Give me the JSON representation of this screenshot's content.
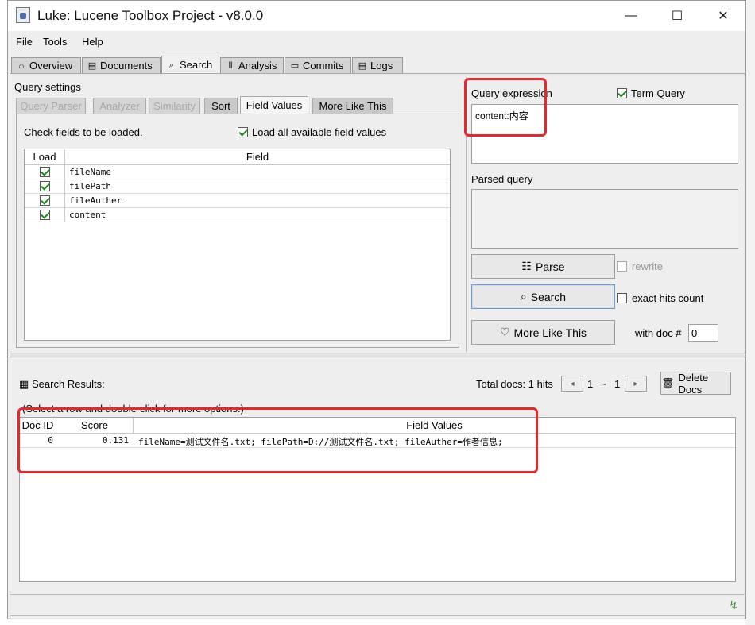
{
  "window": {
    "title": "Luke: Lucene Toolbox Project - v8.0.0"
  },
  "menu": [
    "File",
    "Tools",
    "Help"
  ],
  "main_tabs": [
    {
      "label": "Overview",
      "icon": "home-icon"
    },
    {
      "label": "Documents",
      "icon": "book-icon"
    },
    {
      "label": "Search",
      "icon": "search-doc-icon",
      "active": true
    },
    {
      "label": "Analysis",
      "icon": "analysis-icon"
    },
    {
      "label": "Commits",
      "icon": "commits-icon"
    },
    {
      "label": "Logs",
      "icon": "logs-icon"
    }
  ],
  "query_settings": {
    "title": "Query settings",
    "subtabs": [
      {
        "label": "Query Parser",
        "state": "disabled"
      },
      {
        "label": "Analyzer",
        "state": "disabled"
      },
      {
        "label": "Similarity",
        "state": "disabled"
      },
      {
        "label": "Sort",
        "state": "normal"
      },
      {
        "label": "Field Values",
        "state": "active"
      },
      {
        "label": "More Like This",
        "state": "normal"
      }
    ],
    "check_fields_label": "Check fields to be loaded.",
    "load_all_label": "Load all available field values",
    "load_all_checked": true,
    "table": {
      "headers": [
        "Load",
        "Field"
      ],
      "rows": [
        {
          "load": true,
          "field": "fileName"
        },
        {
          "load": true,
          "field": "filePath"
        },
        {
          "load": true,
          "field": "fileAuther"
        },
        {
          "load": true,
          "field": "content"
        }
      ]
    }
  },
  "query": {
    "expression_label": "Query expression",
    "term_query_label": "Term Query",
    "term_query_checked": true,
    "expression_value": "content:内容",
    "parsed_label": "Parsed query",
    "parsed_value": "",
    "parse_button": "Parse",
    "rewrite_label": "rewrite",
    "search_button": "Search",
    "exact_hits_label": "exact hits count",
    "more_like_this_button": "More Like This",
    "with_doc_label": "with doc #",
    "with_doc_value": "0"
  },
  "results": {
    "title": "Search Results:",
    "total_docs_label": "Total docs: 1 hits",
    "page_from": "1",
    "page_sep": "~",
    "page_to": "1",
    "delete_button": "Delete Docs",
    "hint": "(Select a row and double-click for more options.)",
    "headers": [
      "Doc ID",
      "Score",
      "Field Values"
    ],
    "rows": [
      {
        "doc_id": "0",
        "score": "0.131",
        "values": "fileName=测试文件名.txt; filePath=D://测试文件名.txt; fileAuther=作者信息;"
      }
    ]
  },
  "colors": {
    "highlight_box": "#e8262b",
    "check_green": "#1a8a1a"
  }
}
